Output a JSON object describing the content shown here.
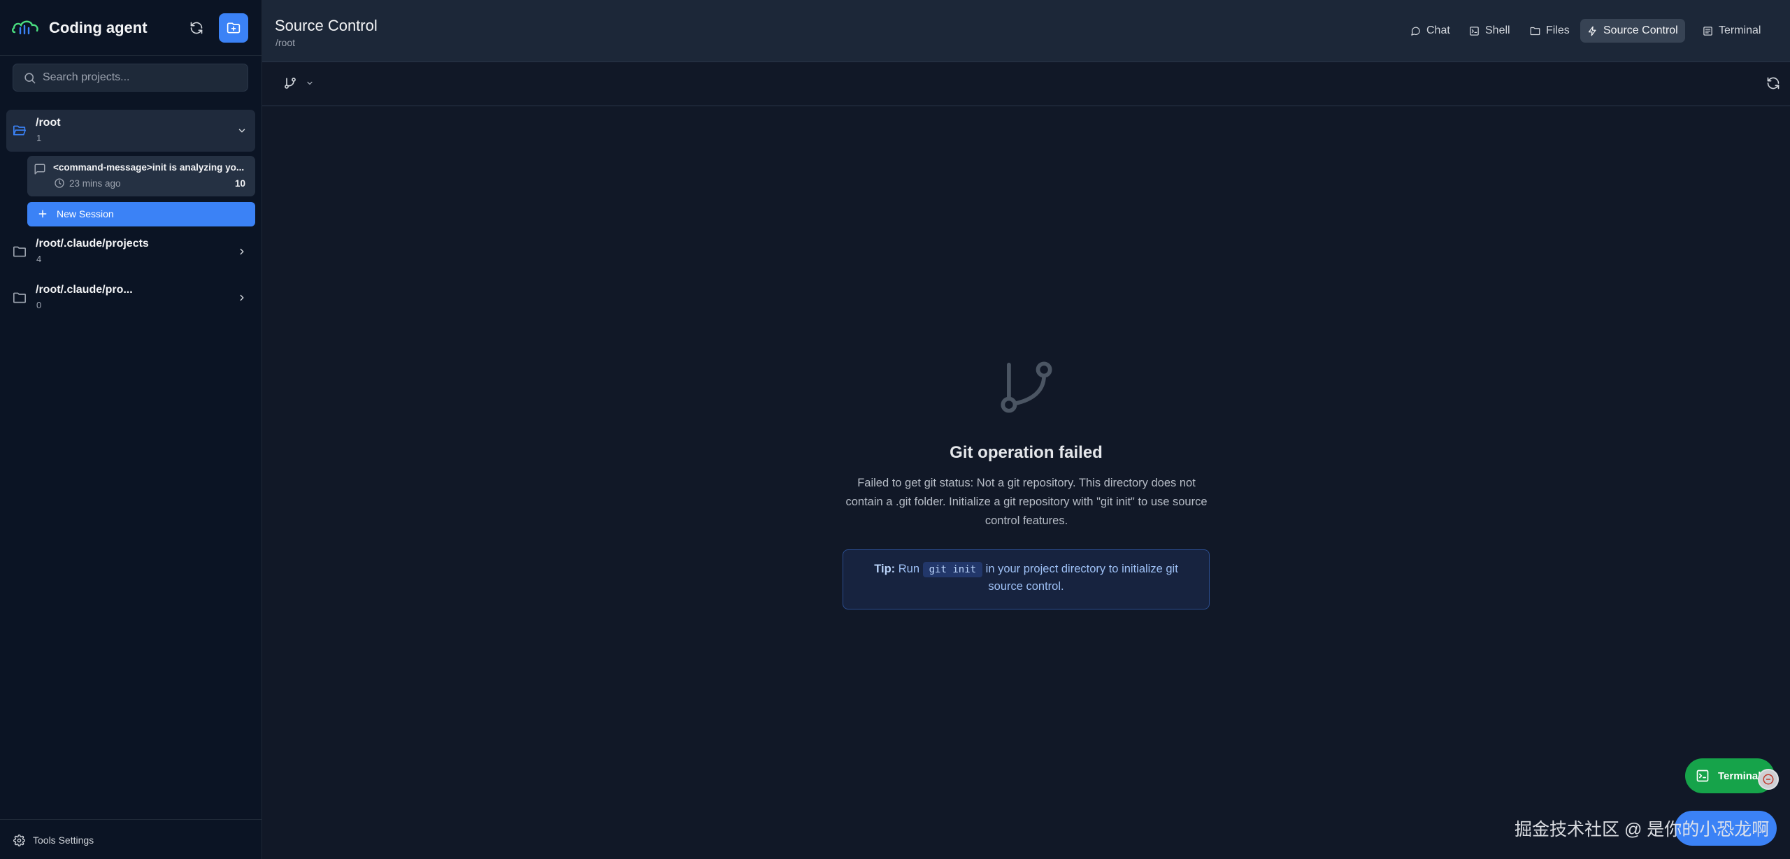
{
  "app": {
    "title": "Coding agent"
  },
  "sidebar": {
    "search": {
      "placeholder": "Search projects..."
    },
    "projects": [
      {
        "name": "/root",
        "count": "1",
        "expanded": true,
        "sessions": [
          {
            "title": "<command-message>init is analyzing yo...",
            "time": "23 mins ago",
            "messages": "10"
          }
        ],
        "new_session_label": "New Session"
      },
      {
        "name": "/root/.claude/projects",
        "count": "4",
        "expanded": false
      },
      {
        "name": "/root/.claude/pro...",
        "count": "0",
        "expanded": false
      }
    ],
    "footer": {
      "label": "Tools Settings"
    }
  },
  "header": {
    "title": "Source Control",
    "path": "/root",
    "tabs": [
      {
        "label": "Chat",
        "icon": "chat-bubble-icon",
        "active": false
      },
      {
        "label": "Shell",
        "icon": "terminal-icon",
        "active": false
      },
      {
        "label": "Files",
        "icon": "folder-icon",
        "active": false
      },
      {
        "label": "Source Control",
        "icon": "git-icon",
        "active": true
      },
      {
        "label": "Terminal",
        "icon": "terminal-window-icon",
        "active": false
      }
    ]
  },
  "main": {
    "error_title": "Git operation failed",
    "error_message": "Failed to get git status: Not a git repository. This directory does not contain a .git folder. Initialize a git repository with \"git init\" to use source control features.",
    "tip": {
      "label": "Tip:",
      "before": "Run",
      "code": "git init",
      "after": "in your project directory to initialize git source control."
    }
  },
  "floating": {
    "terminal_button": "Terminal",
    "watermark": "掘金技术社区 @ 是你的小恐龙啊"
  },
  "colors": {
    "accent": "#3b82f6",
    "sidebar_bg": "#0b1424",
    "main_bg": "#111827",
    "success": "#16a34a"
  }
}
